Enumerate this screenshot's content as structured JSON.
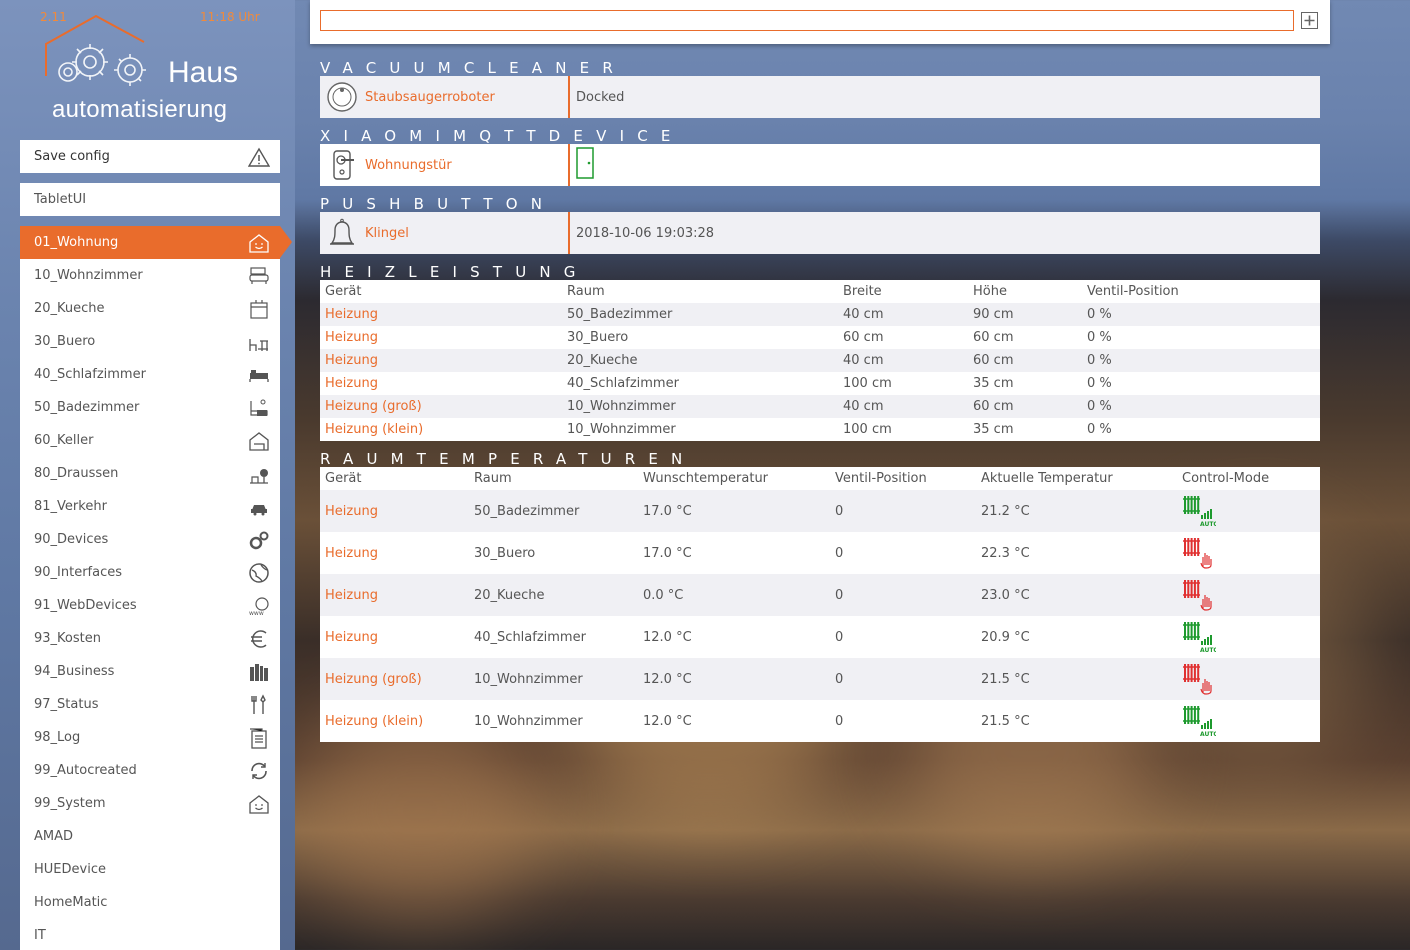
{
  "header": {
    "date": "2.11",
    "time": "11:18 Uhr",
    "logo_line1": "Haus",
    "logo_line2": "automatisierung"
  },
  "sidebar": {
    "save_label": "Save config",
    "tablet_label": "TabletUI",
    "items": [
      {
        "label": "01_Wohnung",
        "icon": "house-smile-icon",
        "active": true
      },
      {
        "label": "10_Wohnzimmer",
        "icon": "sofa-icon"
      },
      {
        "label": "20_Kueche",
        "icon": "kitchen-icon"
      },
      {
        "label": "30_Buero",
        "icon": "desk-chair-icon"
      },
      {
        "label": "40_Schlafzimmer",
        "icon": "bed-icon"
      },
      {
        "label": "50_Badezimmer",
        "icon": "bathtub-icon"
      },
      {
        "label": "60_Keller",
        "icon": "cellar-icon"
      },
      {
        "label": "80_Draussen",
        "icon": "garden-icon"
      },
      {
        "label": "81_Verkehr",
        "icon": "car-icon"
      },
      {
        "label": "90_Devices",
        "icon": "gears-icon"
      },
      {
        "label": "90_Interfaces",
        "icon": "globe-icon"
      },
      {
        "label": "91_WebDevices",
        "icon": "www-icon"
      },
      {
        "label": "93_Kosten",
        "icon": "euro-icon"
      },
      {
        "label": "94_Business",
        "icon": "books-icon"
      },
      {
        "label": "97_Status",
        "icon": "tools-icon"
      },
      {
        "label": "98_Log",
        "icon": "log-icon"
      },
      {
        "label": "99_Autocreated",
        "icon": "refresh-icon"
      },
      {
        "label": "99_System",
        "icon": "house-smile-icon"
      },
      {
        "label": "AMAD",
        "icon": ""
      },
      {
        "label": "HUEDevice",
        "icon": ""
      },
      {
        "label": "HomeMatic",
        "icon": ""
      },
      {
        "label": "IT",
        "icon": ""
      }
    ]
  },
  "search": {
    "placeholder": ""
  },
  "sections": {
    "vacuum": {
      "title": "VACUUMCLEANER",
      "device": "Staubsaugerroboter",
      "state": "Docked"
    },
    "xiaomi": {
      "title": "XIAOMIMQTTDEVICE",
      "device": "Wohnungstür",
      "state": ""
    },
    "pushbutton": {
      "title": "PUSHBUTTON",
      "device": "Klingel",
      "state": "2018-10-06 19:03:28"
    },
    "heizleistung": {
      "title": "HEIZLEISTUNG",
      "headers": [
        "Gerät",
        "Raum",
        "Breite",
        "Höhe",
        "Ventil-Position"
      ],
      "rows": [
        [
          "Heizung",
          "50_Badezimmer",
          "40 cm",
          "90 cm",
          "0 %"
        ],
        [
          "Heizung",
          "30_Buero",
          "60 cm",
          "60 cm",
          "0 %"
        ],
        [
          "Heizung",
          "20_Kueche",
          "40 cm",
          "60 cm",
          "0 %"
        ],
        [
          "Heizung",
          "40_Schlafzimmer",
          "100 cm",
          "35 cm",
          "0 %"
        ],
        [
          "Heizung (groß)",
          "10_Wohnzimmer",
          "40 cm",
          "60 cm",
          "0 %"
        ],
        [
          "Heizung (klein)",
          "10_Wohnzimmer",
          "100 cm",
          "35 cm",
          "0 %"
        ]
      ]
    },
    "raumtemperaturen": {
      "title": "RAUMTEMPERATUREN",
      "headers": [
        "Gerät",
        "Raum",
        "Wunschtemperatur",
        "Ventil-Position",
        "Aktuelle Temperatur",
        "Control-Mode"
      ],
      "rows": [
        [
          "Heizung",
          "50_Badezimmer",
          "17.0 °C",
          "0",
          "21.2 °C",
          "auto"
        ],
        [
          "Heizung",
          "30_Buero",
          "17.0 °C",
          "0",
          "22.3 °C",
          "manual"
        ],
        [
          "Heizung",
          "20_Kueche",
          "0.0 °C",
          "0",
          "23.0 °C",
          "manual"
        ],
        [
          "Heizung",
          "40_Schlafzimmer",
          "12.0 °C",
          "0",
          "20.9 °C",
          "auto"
        ],
        [
          "Heizung (groß)",
          "10_Wohnzimmer",
          "12.0 °C",
          "0",
          "21.5 °C",
          "manual"
        ],
        [
          "Heizung (klein)",
          "10_Wohnzimmer",
          "12.0 °C",
          "0",
          "21.5 °C",
          "auto"
        ]
      ],
      "auto_label": "AUTO"
    }
  },
  "colors": {
    "accent": "#e96c2c",
    "auto": "#1e9a2e",
    "manual": "#e03030"
  }
}
